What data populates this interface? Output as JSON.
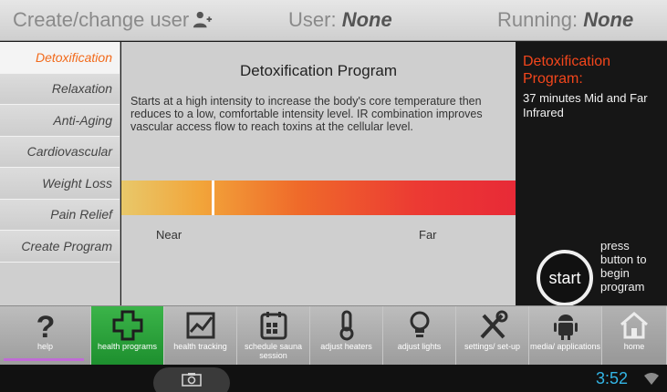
{
  "header": {
    "create_label": "Create/change user",
    "create_icon": "user-add-icon",
    "user_label": "User:",
    "user_value": "None",
    "running_label": "Running:",
    "running_value": "None"
  },
  "sidebar": {
    "items": [
      {
        "label": "Detoxification",
        "active": true
      },
      {
        "label": "Relaxation"
      },
      {
        "label": "Anti-Aging"
      },
      {
        "label": "Cardiovascular"
      },
      {
        "label": "Weight Loss"
      },
      {
        "label": "Pain Relief"
      },
      {
        "label": "Create Program"
      }
    ]
  },
  "program": {
    "title": "Detoxification Program",
    "description": "Starts at a high intensity to increase the body's core temperature then reduces to a low, comfortable intensity level. IR combination improves vascular access flow to reach toxins at the cellular level.",
    "near_label": "Near",
    "far_label": "Far",
    "ir_position_fraction": 0.23
  },
  "right_panel": {
    "title": "Detoxification Program:",
    "detail": "37 minutes Mid and Far Infrared",
    "start_label": "start",
    "hint": "press button to begin program"
  },
  "toolbar": {
    "items": [
      {
        "label": "help",
        "icon": "help-icon"
      },
      {
        "label": "health programs",
        "icon": "health-cross-icon",
        "active": true
      },
      {
        "label": "health tracking",
        "icon": "chart-icon"
      },
      {
        "label": "schedule sauna session",
        "icon": "calendar-icon"
      },
      {
        "label": "adjust heaters",
        "icon": "thermometer-icon"
      },
      {
        "label": "adjust lights",
        "icon": "lightbulb-icon"
      },
      {
        "label": "settings/ set-up",
        "icon": "tools-icon"
      },
      {
        "label": "media/ applications",
        "icon": "android-icon"
      },
      {
        "label": "home",
        "icon": "home-icon"
      }
    ]
  },
  "statusbar": {
    "time": "3:52",
    "camera_icon": "camera-icon",
    "wifi_icon": "wifi-icon"
  },
  "colors": {
    "accent_orange": "#f26a1b",
    "active_green": "#2aa23c",
    "clock_blue": "#33b5e5"
  }
}
